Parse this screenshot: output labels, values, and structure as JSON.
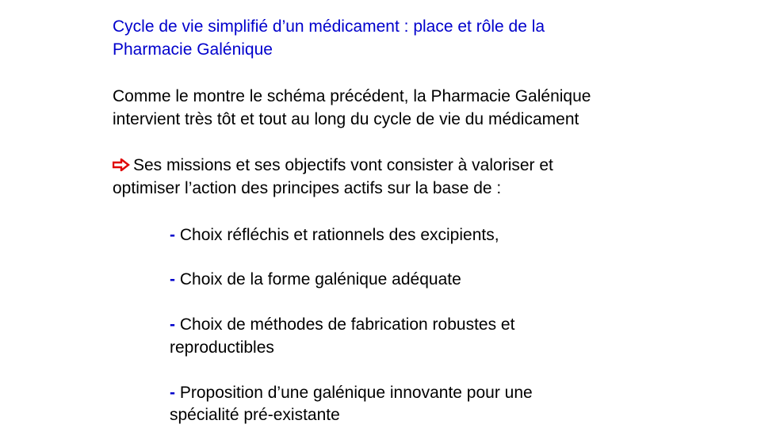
{
  "title": {
    "line1": "Cycle de vie simplifié d’un médicament : place et rôle de la",
    "line2": "Pharmacie Galénique"
  },
  "intro": {
    "line1": "Comme le montre le schéma précédent, la Pharmacie Galénique",
    "line2": "intervient très tôt et tout au long du cycle de vie du médicament"
  },
  "missions": {
    "icon": "arrow-right-icon",
    "icon_color": "#e00000",
    "line1": "Ses missions et ses objectifs vont consister à valoriser et",
    "line2": "optimiser l’action des principes actifs sur la base de :"
  },
  "items": [
    {
      "dash": "-",
      "lines": [
        "Choix réfléchis et rationnels des excipients,"
      ]
    },
    {
      "dash": "-",
      "lines": [
        "Choix de la forme galénique adéquate"
      ]
    },
    {
      "dash": "-",
      "lines": [
        "Choix de méthodes de fabrication robustes et",
        "reproductibles"
      ]
    },
    {
      "dash": "-",
      "lines": [
        "Proposition d’une galénique innovante pour une",
        "spécialité pré-existante"
      ]
    }
  ],
  "colors": {
    "title": "#0000cc",
    "dash": "#0000cc",
    "text": "#000000"
  }
}
